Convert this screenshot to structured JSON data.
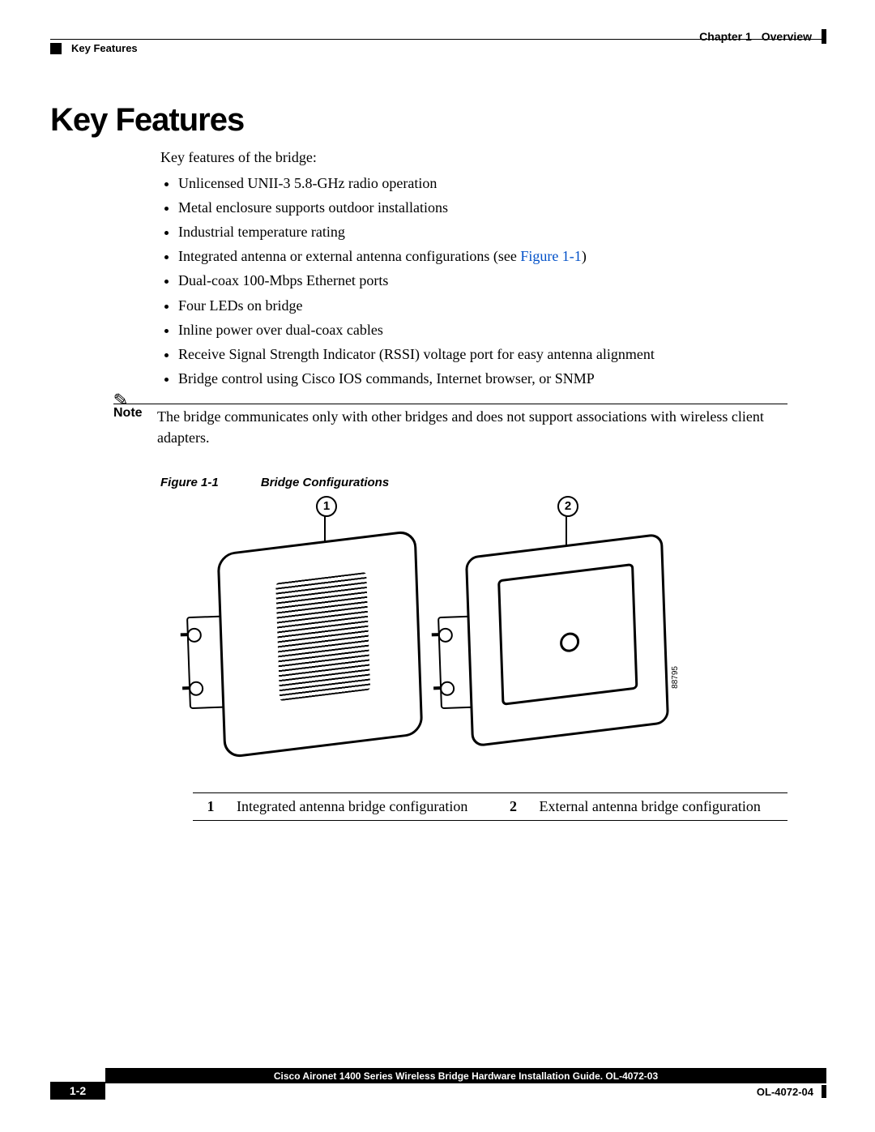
{
  "header": {
    "chapter_label": "Chapter 1",
    "chapter_title": "Overview",
    "section_crumb": "Key Features"
  },
  "section_heading": "Key Features",
  "intro": "Key features of the bridge:",
  "features": [
    "Unlicensed UNII-3 5.8-GHz radio operation",
    "Metal enclosure supports outdoor installations",
    "Industrial temperature rating",
    "Integrated antenna or external antenna configurations (see ",
    "Dual-coax 100-Mbps Ethernet ports",
    "Four LEDs on bridge",
    "Inline power over dual-coax cables",
    "Receive Signal Strength Indicator (RSSI) voltage port for easy antenna alignment",
    "Bridge control using Cisco IOS commands, Internet browser, or SNMP"
  ],
  "feature_link_text": "Figure 1-1",
  "feature_link_suffix": ")",
  "note": {
    "label": "Note",
    "body": "The bridge communicates only with other bridges and does not support associations with wireless client adapters."
  },
  "figure": {
    "label": "Figure 1-1",
    "title": "Bridge Configurations",
    "callouts": {
      "c1": "1",
      "c2": "2"
    },
    "part_number": "88795",
    "legend": [
      {
        "num": "1",
        "text": "Integrated antenna bridge configuration"
      },
      {
        "num": "2",
        "text": "External antenna bridge configuration"
      }
    ]
  },
  "footer": {
    "doc_title": "Cisco Aironet 1400 Series Wireless Bridge Hardware Installation Guide. OL-4072-03",
    "page": "1-2",
    "doc_id": "OL-4072-04"
  }
}
